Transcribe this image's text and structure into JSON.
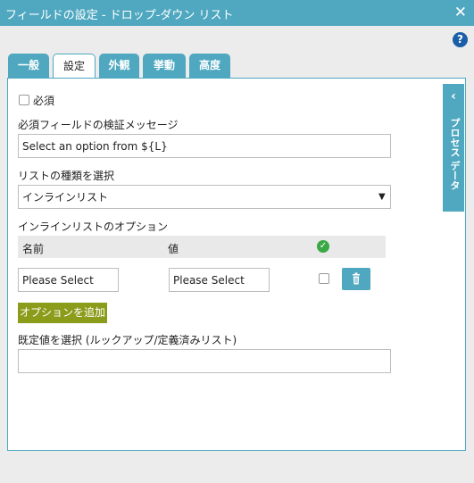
{
  "window": {
    "title": "フィールドの設定 - ドロップ-ダウン リスト",
    "close_glyph": "✕"
  },
  "help": {
    "glyph": "?"
  },
  "tabs": [
    {
      "label": "一般"
    },
    {
      "label": "設定"
    },
    {
      "label": "外観"
    },
    {
      "label": "挙動"
    },
    {
      "label": "高度"
    }
  ],
  "active_tab": "設定",
  "settings": {
    "required_label": "必須",
    "required_checked": false,
    "validation_message_label": "必須フィールドの検証メッセージ",
    "validation_message_value": "Select an option from ${L}",
    "list_type_label": "リストの種類を選択",
    "list_type_value": "インラインリスト",
    "inline_options_label": "インラインリストのオプション",
    "options_table": {
      "headers": {
        "name": "名前",
        "value": "値"
      },
      "rows": [
        {
          "name": "Please Select",
          "value": "Please Select",
          "default_checked": false
        }
      ]
    },
    "add_option_label": "オプションを追加",
    "default_value_label": "既定値を選択 (ルックアップ/定義済みリスト)",
    "default_value": ""
  },
  "side_panel": {
    "label": "プロセス データ",
    "chevron": "‹"
  },
  "colors": {
    "accent": "#4fa8c0",
    "add_button": "#8b9c1b",
    "check_green": "#39a845",
    "help_blue": "#1b5ea8"
  }
}
